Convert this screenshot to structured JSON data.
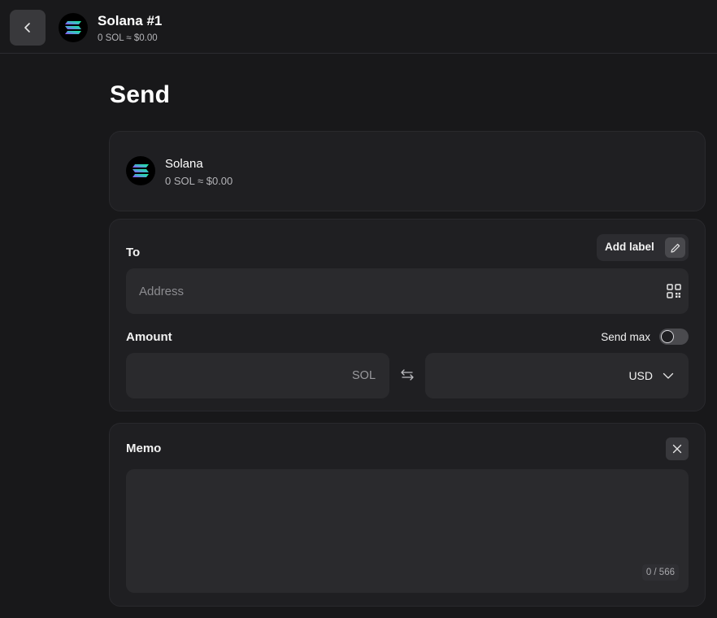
{
  "header": {
    "title": "Solana #1",
    "balance": "0 SOL ≈ $0.00"
  },
  "page": {
    "title": "Send"
  },
  "asset": {
    "name": "Solana",
    "balance": "0 SOL ≈ $0.00"
  },
  "to": {
    "label": "To",
    "add_label": "Add label",
    "address_placeholder": "Address"
  },
  "amount": {
    "label": "Amount",
    "send_max_label": "Send max",
    "send_max_on": false,
    "unit": "SOL",
    "currency": "USD"
  },
  "memo": {
    "label": "Memo",
    "counter": "0 / 566"
  },
  "colors": {
    "background": "#18181a",
    "card": "#1f1f22",
    "input": "#2a2a2d",
    "accent_purple": "#9945FF",
    "accent_green": "#14F195"
  },
  "icons": [
    "chevron-left-icon",
    "solana-logo-icon",
    "pencil-icon",
    "qr-code-icon",
    "swap-icon",
    "chevron-down-icon",
    "close-icon"
  ]
}
